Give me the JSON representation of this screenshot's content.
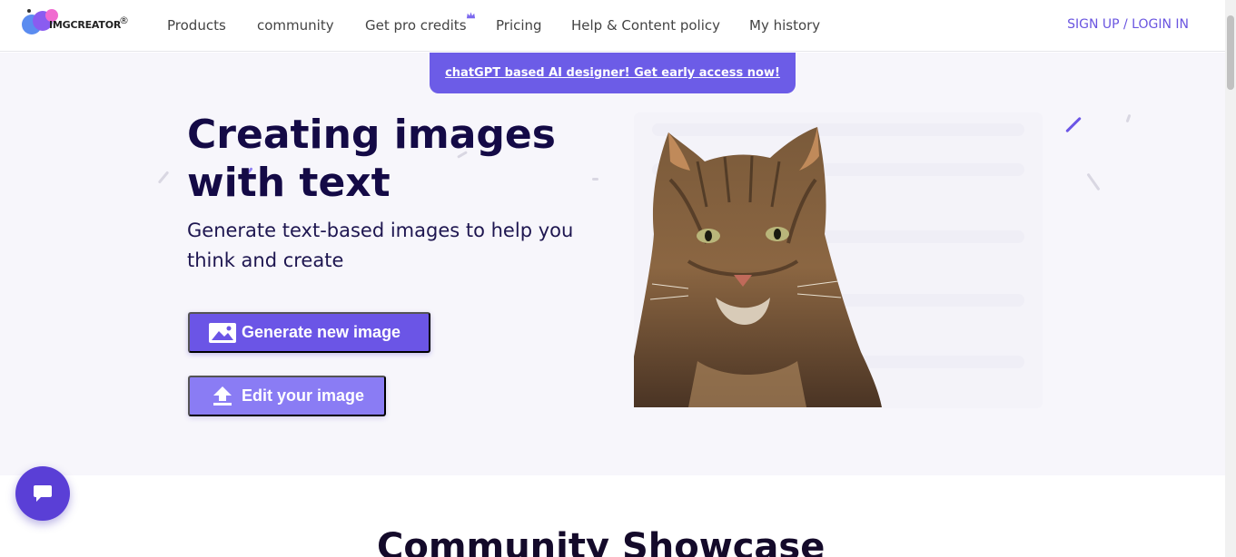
{
  "brand": {
    "name": "IMGCREATOR",
    "mark": "®"
  },
  "nav": {
    "items": [
      "Products",
      "community",
      "Get pro credits",
      "Pricing",
      "Help & Content policy",
      "My history"
    ],
    "auth_label": "SIGN UP / LOGIN IN"
  },
  "banner": {
    "text": "chatGPT based AI designer! Get early access now!"
  },
  "hero": {
    "title": "Creating images with text",
    "subtitle": "Generate text-based images to help you think and create",
    "generate_label": "Generate new image",
    "edit_label": "Edit your image"
  },
  "showcase": {
    "title": "Community Showcase"
  },
  "icons": {
    "image": "image-icon",
    "upload": "upload-icon",
    "crown": "crown-icon",
    "chat": "chat-icon"
  },
  "colors": {
    "accent": "#6b55e6",
    "accent_light": "#8a7cf4",
    "banner": "#6c5ce7",
    "title": "#140a46",
    "link": "#6a55e0"
  }
}
